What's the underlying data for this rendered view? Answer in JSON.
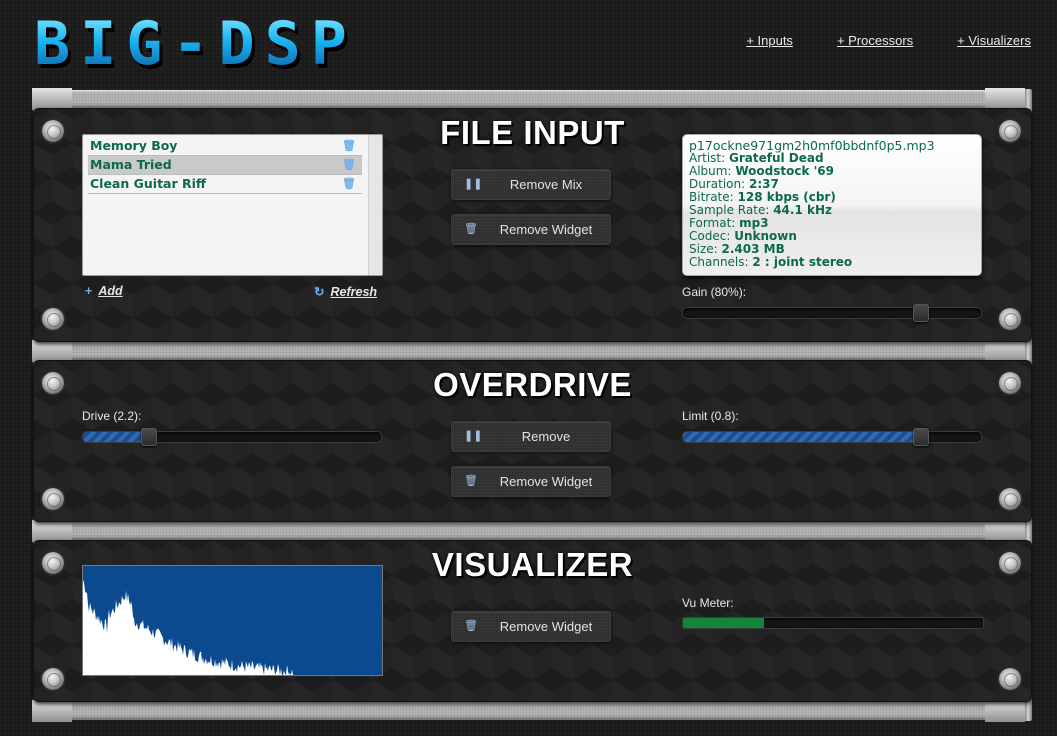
{
  "app": {
    "logo": "BIG-DSP"
  },
  "nav": {
    "inputs": "+ Inputs",
    "processors": "+ Processors",
    "visualizers": "+ Visualizers"
  },
  "file_input": {
    "title": "FILE INPUT",
    "files": [
      {
        "name": "Memory Boy",
        "selected": false
      },
      {
        "name": "Mama Tried",
        "selected": true
      },
      {
        "name": "Clean Guitar Riff",
        "selected": false
      }
    ],
    "add_label": "Add",
    "refresh_label": "Refresh",
    "remove_mix_label": "Remove Mix",
    "remove_widget_label": "Remove Widget",
    "info": {
      "filename": "p17ockne971gm2h0mf0bbdnf0p5.mp3",
      "artist_key": "Artist:",
      "artist": "Grateful Dead",
      "album_key": "Album:",
      "album": "Woodstock '69",
      "duration_key": "Duration:",
      "duration": "2:37",
      "bitrate_key": "Bitrate:",
      "bitrate": "128 kbps (cbr)",
      "samplerate_key": "Sample Rate:",
      "samplerate": "44.1 kHz",
      "format_key": "Format:",
      "format": "mp3",
      "codec_key": "Codec:",
      "codec": "Unknown",
      "size_key": "Size:",
      "size": "2.403 MB",
      "channels_key": "Channels:",
      "channels": "2 : joint stereo"
    },
    "gain_label": "Gain (80%):",
    "gain_value": 0.8
  },
  "overdrive": {
    "title": "OVERDRIVE",
    "drive_label": "Drive (2.2):",
    "drive_fraction": 0.22,
    "limit_label": "Limit (0.8):",
    "limit_fraction": 0.8,
    "remove_label": "Remove",
    "remove_widget_label": "Remove Widget"
  },
  "visualizer": {
    "title": "VISUALIZER",
    "vu_label": "Vu Meter:",
    "vu_level": 0.27,
    "remove_widget_label": "Remove Widget"
  },
  "colors": {
    "accent_blue": "#0b4a8e",
    "text_green": "#0c6a45",
    "vu_green": "#13843a"
  },
  "icons": {
    "pause": "pause-icon",
    "trash": "trash-icon",
    "plus": "plus-icon",
    "refresh": "refresh-icon"
  }
}
